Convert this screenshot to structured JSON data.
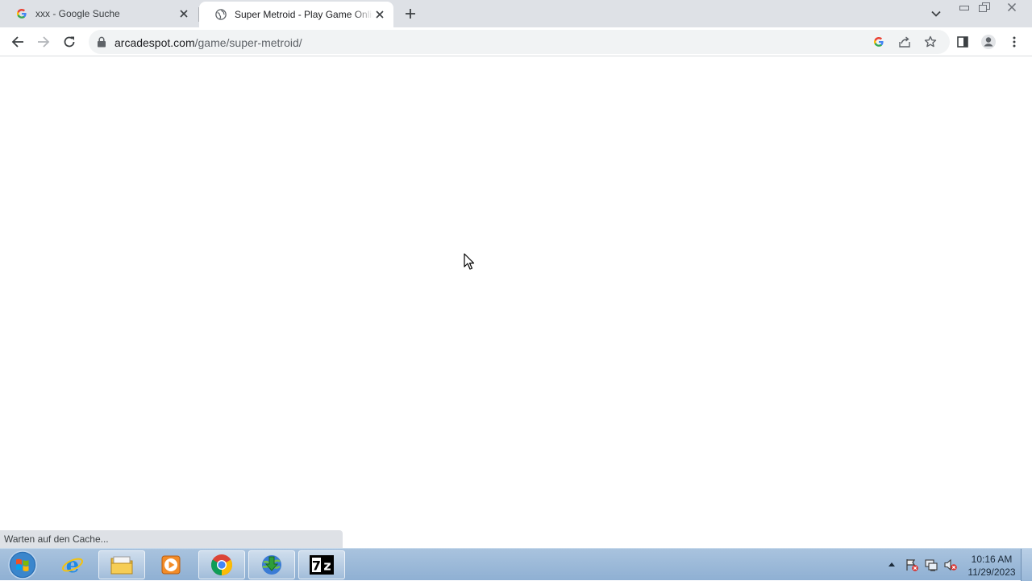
{
  "browser": {
    "tabs": [
      {
        "title": "xxx - Google Suche",
        "icon": "google-g-icon",
        "active": false
      },
      {
        "title": "Super Metroid - Play Game Online",
        "icon": "globe-icon",
        "active": true
      }
    ],
    "address": {
      "host": "arcadespot.com",
      "path": "/game/super-metroid/"
    },
    "status_text": "Warten auf den Cache..."
  },
  "taskbar": {
    "apps": [
      "windows-start",
      "internet-explorer",
      "file-explorer",
      "media-player",
      "google-chrome",
      "internet-download-manager",
      "7-zip"
    ],
    "clock": {
      "time": "10:16 AM",
      "date": "11/29/2023"
    }
  },
  "colors": {
    "tabstrip": "#dee1e6",
    "omnibox": "#f1f3f4",
    "taskbar": "#9fbbdb",
    "chrome_red": "#ea4335",
    "chrome_green": "#34a853",
    "chrome_yellow": "#fbbc05",
    "chrome_blue": "#4285f4"
  }
}
